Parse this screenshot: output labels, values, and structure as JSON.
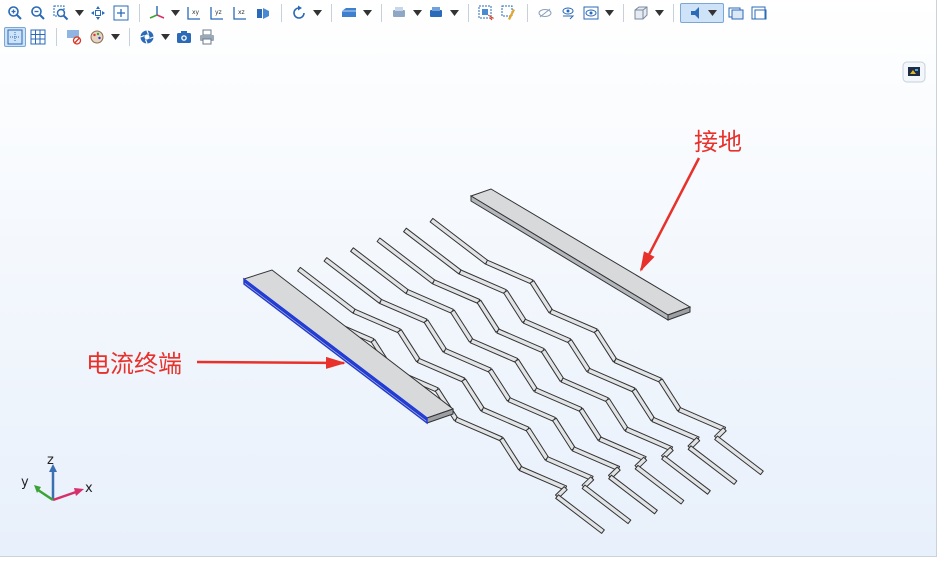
{
  "annotations": {
    "ground": "接地",
    "terminal": "电流终端"
  },
  "axes": {
    "x": "x",
    "y": "y",
    "z": "z"
  },
  "icons": {
    "row1": [
      "zoom-in-icon",
      "zoom-out-icon",
      "zoom-box-icon",
      "move-icon",
      "zoom-extents-icon",
      "view-axes-icon",
      "view-xy-icon",
      "view-yz-icon",
      "view-xz-icon",
      "light-icon",
      "rotate-icon",
      "wireframe-render-icon",
      "scene-light-icon",
      "print-view-icon",
      "select-box-icon",
      "select-brush-icon",
      "hide-icon",
      "show-hidden-icon",
      "show-icon",
      "transparency-icon",
      "active-view-icon",
      "view-a-icon",
      "view-b-icon"
    ],
    "row2": [
      "grid-toggle-icon",
      "table-icon",
      "clear-selection-icon",
      "appearance-icon",
      "camera-settings-icon",
      "screenshot-icon",
      "print-icon"
    ]
  },
  "colors": {
    "annotation": "#e8312a",
    "model_fill": "#e2e3e5",
    "model_edge": "#333333",
    "terminal_edge": "#1f3ad6",
    "axis_x": "#d62f6a",
    "axis_y": "#3aa335",
    "axis_z": "#3a6fb0"
  }
}
